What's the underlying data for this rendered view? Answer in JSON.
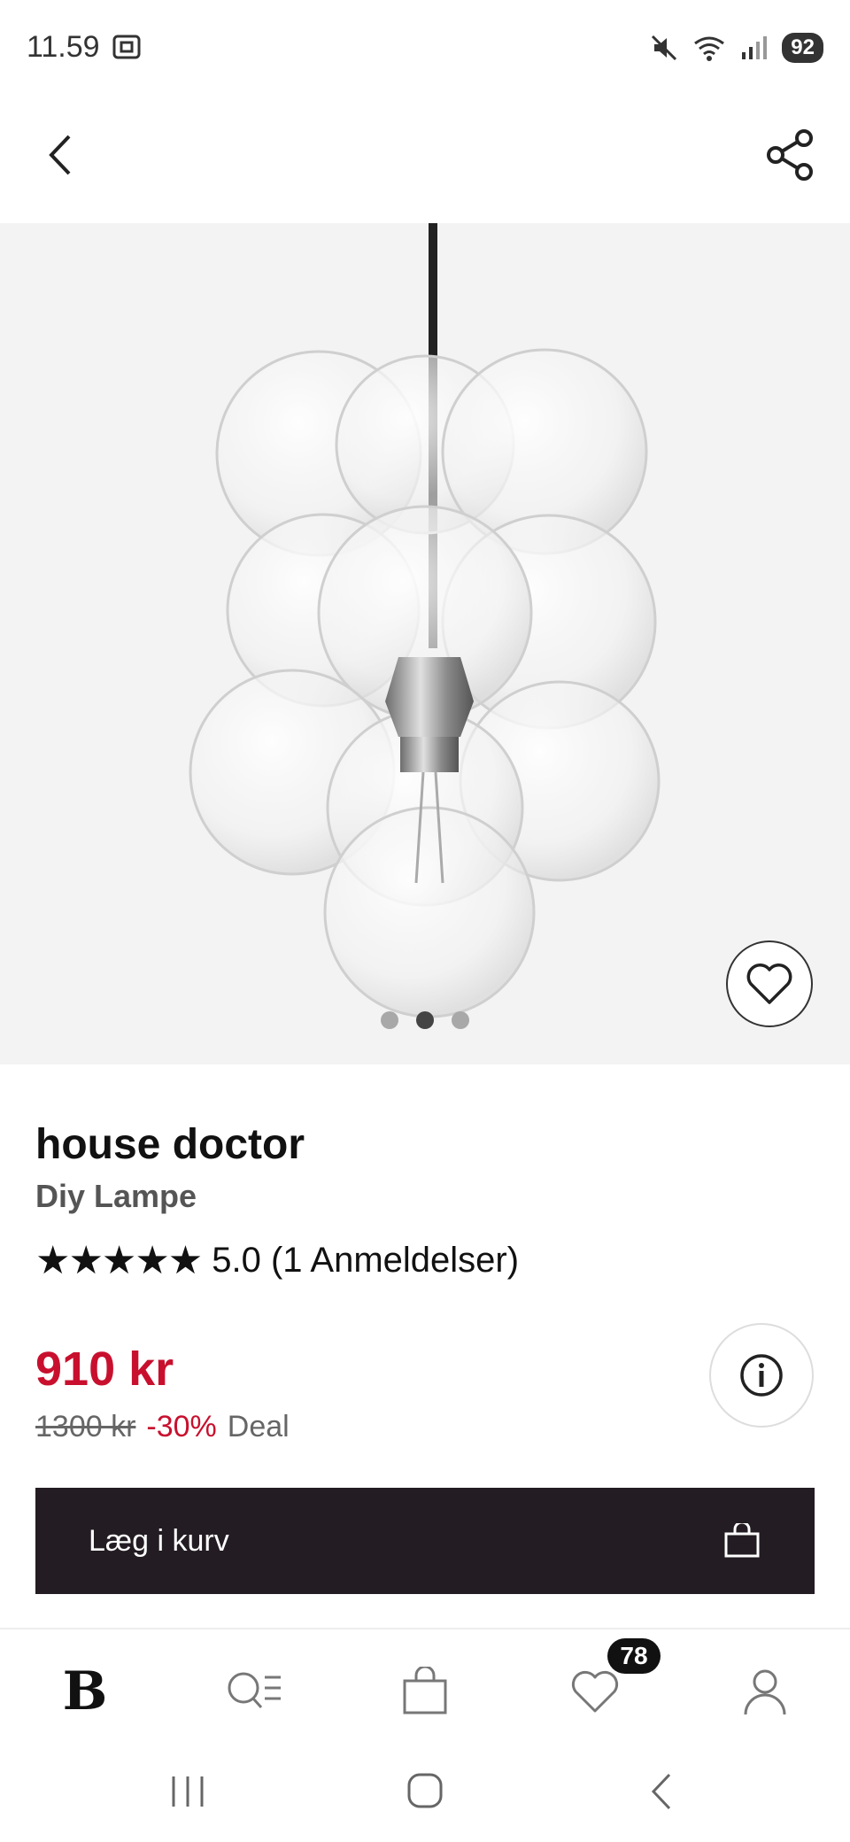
{
  "status_bar": {
    "time": "11.59",
    "battery": "92",
    "icons": [
      "screenshot-icon",
      "mute-icon",
      "wifi-icon",
      "signal-icon",
      "battery-icon"
    ]
  },
  "top_nav": {
    "icons": [
      "back-arrow-icon",
      "share-icon"
    ]
  },
  "gallery": {
    "image": "glass-bubble-pendant-lamp",
    "dot_count": 3,
    "active_dot": 1
  },
  "product": {
    "brand": "house doctor",
    "name": "Diy Lampe",
    "stars": "★★★★★",
    "rating_text": "5.0 (1 Anmeldelser)",
    "price": "910 kr",
    "old_price": "1300 kr",
    "discount": "-30%",
    "deal_label": "Deal"
  },
  "actions": {
    "add_to_cart": "Læg i kurv"
  },
  "tab_bar": {
    "logo": "B",
    "favorites_badge": "78",
    "icons": [
      "search-menu-icon",
      "bag-icon",
      "heart-icon",
      "profile-icon"
    ]
  },
  "colors": {
    "price_red": "#c8102e",
    "cart_bg": "#231c22",
    "image_bg": "#f3f3f3"
  }
}
